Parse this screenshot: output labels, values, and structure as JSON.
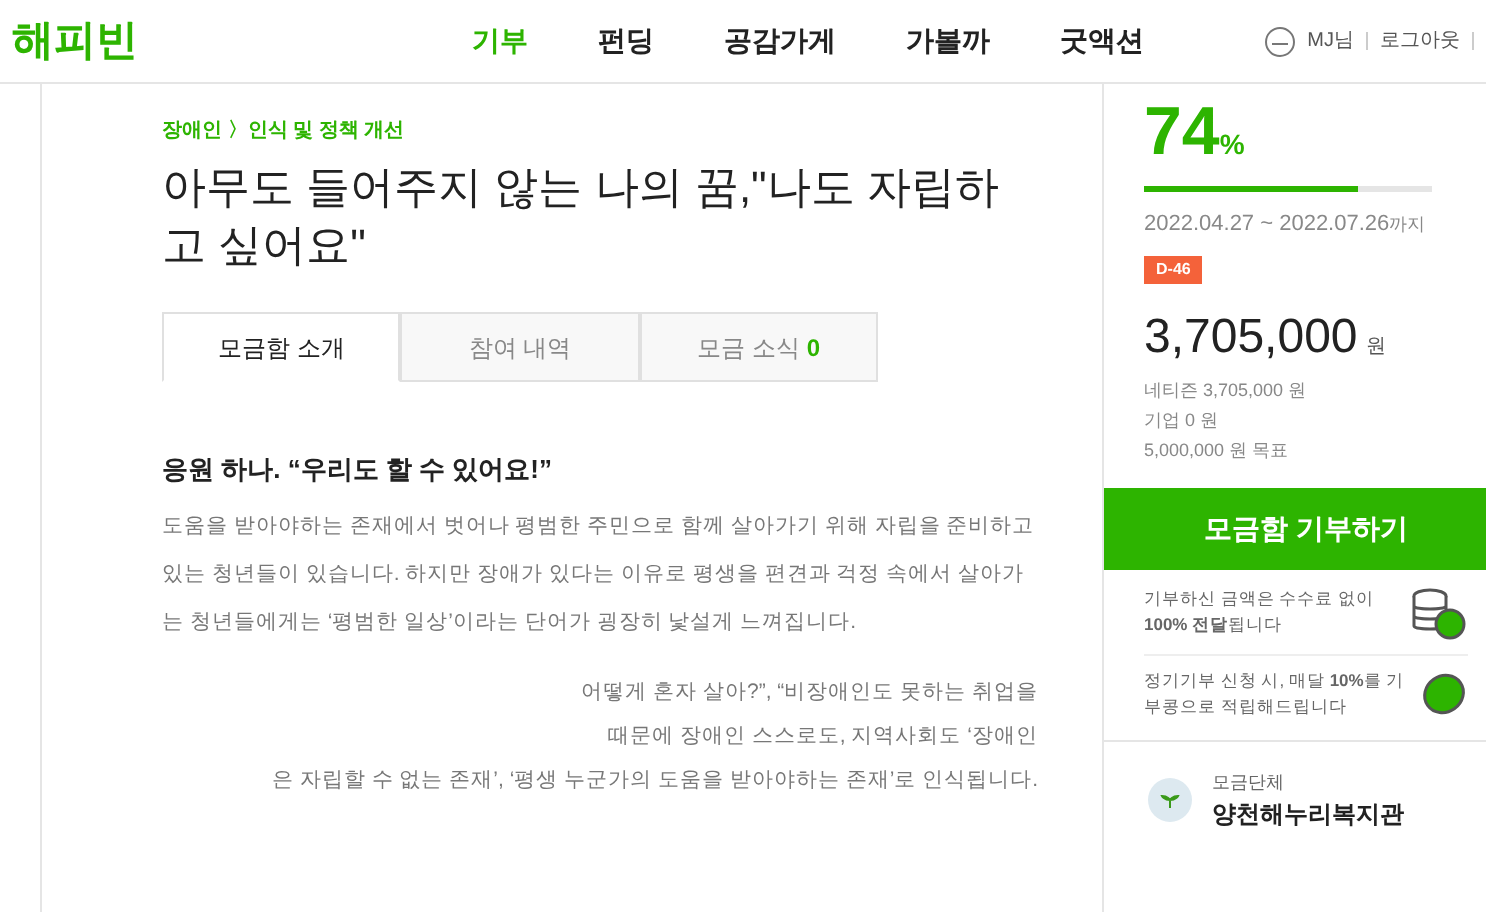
{
  "header": {
    "logo": "해피빈",
    "nav": [
      {
        "label": "기부",
        "selected": true
      },
      {
        "label": "펀딩",
        "selected": false
      },
      {
        "label": "공감가게",
        "selected": false
      },
      {
        "label": "가볼까",
        "selected": false
      },
      {
        "label": "굿액션",
        "selected": false
      }
    ],
    "user": "MJ님",
    "logout": "로그아웃"
  },
  "article": {
    "breadcrumb": "장애인 〉인식 및 정책 개선",
    "title": "아무도 들어주지 않는 나의 꿈,\"나도 자립하고 싶어요\"",
    "tabs": [
      {
        "label": "모금함 소개",
        "selected": true
      },
      {
        "label": "참여 내역",
        "selected": false
      },
      {
        "label": "모금 소식",
        "count": "0",
        "selected": false
      }
    ],
    "heading": "응원 하나. “우리도 할 수 있어요!”",
    "paragraph_1": "도움을 받아야하는 존재에서 벗어나 평범한 주민으로 함께 살아가기 위해 자립을 준비하고 있는 청년들이 있습니다. 하지만 장애가 있다는 이유로 평생을 편견과 걱정 속에서 살아가는 청년들에게는 ‘평범한 일상’이라는 단어가 굉장히 낯설게 느껴집니다.",
    "paragraph_2_lines": [
      "어떻게 혼자 살아?”, “비장애인도 못하는 취업을",
      "때문에 장애인 스스로도, 지역사회도 ‘장애인",
      "은 자립할 수 없는 존재’, ‘평생 누군가의 도움을 받아야하는 존재’로 인식됩니다."
    ]
  },
  "summary": {
    "percent": "74",
    "percent_unit": "%",
    "level": 0.74,
    "period": "2022.04.27 ~ 2022.07.26",
    "period_suffix": "까지",
    "dday": "D-46",
    "amount": "3,705,000",
    "amount_unit": "원",
    "details": [
      "네티즌 3,705,000 원",
      "기업 0 원",
      "5,000,000 원 목표"
    ],
    "donate_button": "모금함 기부하기",
    "notes": [
      {
        "text": "기부하신 금액은 수수료 없이 **100% 전달**됩니다",
        "kind": "coins"
      },
      {
        "text": "정기기부 신청 시, 매달 **10%**를 기부콩으로 적립해드립니다",
        "kind": "bean"
      }
    ],
    "org_label": "모금단체",
    "org_name": "양천해누리복지관"
  }
}
